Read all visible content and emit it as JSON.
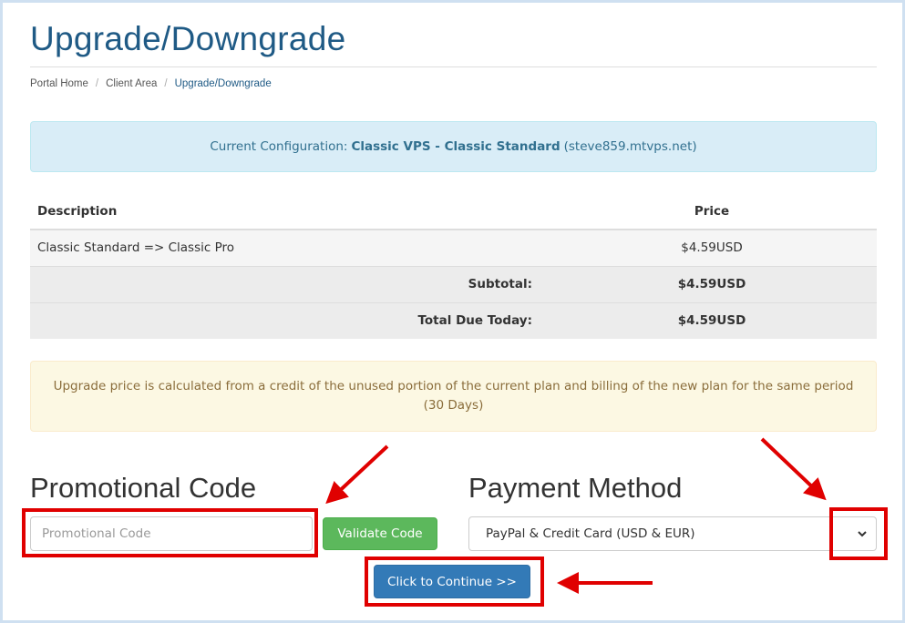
{
  "page": {
    "title": "Upgrade/Downgrade"
  },
  "breadcrumb": {
    "items": [
      "Portal Home",
      "Client Area",
      "Upgrade/Downgrade"
    ],
    "separator": "/"
  },
  "current_config": {
    "prefix": "Current Configuration:",
    "product": "Classic VPS - Classic Standard",
    "hostname": "(steve859.mtvps.net)"
  },
  "table": {
    "headers": {
      "description": "Description",
      "price": "Price"
    },
    "item": {
      "description": "Classic Standard => Classic Pro",
      "price": "$4.59USD"
    },
    "subtotal": {
      "label": "Subtotal:",
      "price": "$4.59USD"
    },
    "total": {
      "label": "Total Due Today:",
      "price": "$4.59USD"
    }
  },
  "notice": {
    "text": "Upgrade price is calculated from a credit of the unused portion of the current plan and billing of the new plan for the same period (30 Days)"
  },
  "promo": {
    "heading": "Promotional Code",
    "placeholder": "Promotional Code",
    "value": "",
    "validate_label": "Validate Code"
  },
  "payment": {
    "heading": "Payment Method",
    "selected": "PayPal & Credit Card (USD & EUR)"
  },
  "continue_label": "Click to Continue >>",
  "colors": {
    "title": "#1f5a85",
    "info_bg": "#d9edf7",
    "warn_bg": "#fcf8e3",
    "success": "#5cb85c",
    "primary": "#337ab7",
    "annotation_red": "#e00000"
  }
}
